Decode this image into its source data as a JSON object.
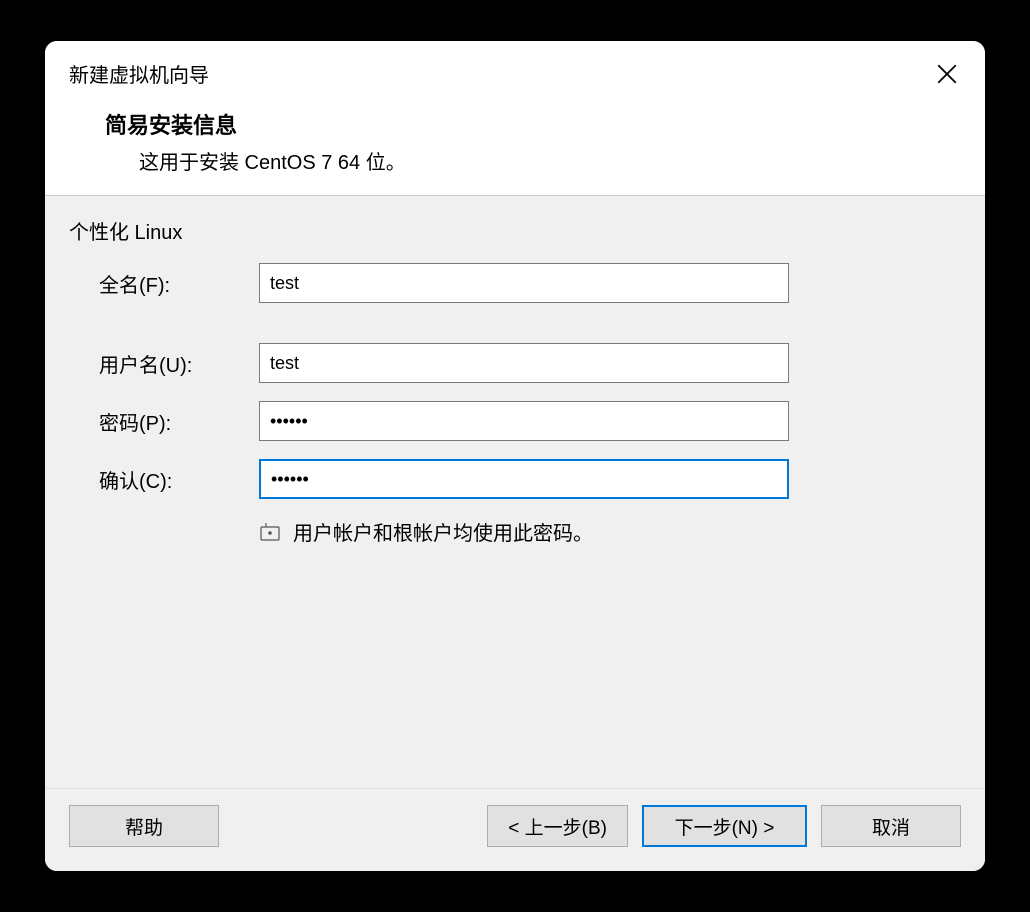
{
  "dialog": {
    "title": "新建虚拟机向导",
    "header_title": "简易安装信息",
    "header_subtitle": "这用于安装 CentOS 7 64 位。"
  },
  "form": {
    "section_label": "个性化 Linux",
    "fullname_label": "全名(F):",
    "fullname_value": "test",
    "username_label": "用户名(U):",
    "username_value": "test",
    "password_label": "密码(P):",
    "password_value": "••••••",
    "confirm_label": "确认(C):",
    "confirm_value": "••••••",
    "info_text": "用户帐户和根帐户均使用此密码。"
  },
  "buttons": {
    "help": "帮助",
    "back": "< 上一步(B)",
    "next": "下一步(N) >",
    "cancel": "取消"
  }
}
